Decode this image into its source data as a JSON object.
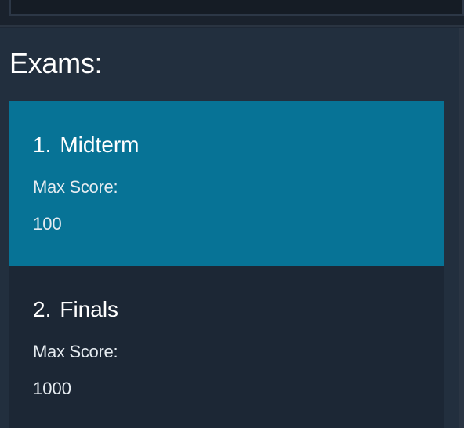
{
  "header": {
    "title": "Exams:"
  },
  "exams": [
    {
      "index": "1.",
      "name": "Midterm",
      "max_score_label": "Max Score:",
      "max_score": "100",
      "selected": true
    },
    {
      "index": "2.",
      "name": "Finals",
      "max_score_label": "Max Score:",
      "max_score": "1000",
      "selected": false
    }
  ],
  "colors": {
    "background": "#222f3e",
    "list_background": "#1c2735",
    "selected_accent": "#077396",
    "text": "#ffffff"
  }
}
